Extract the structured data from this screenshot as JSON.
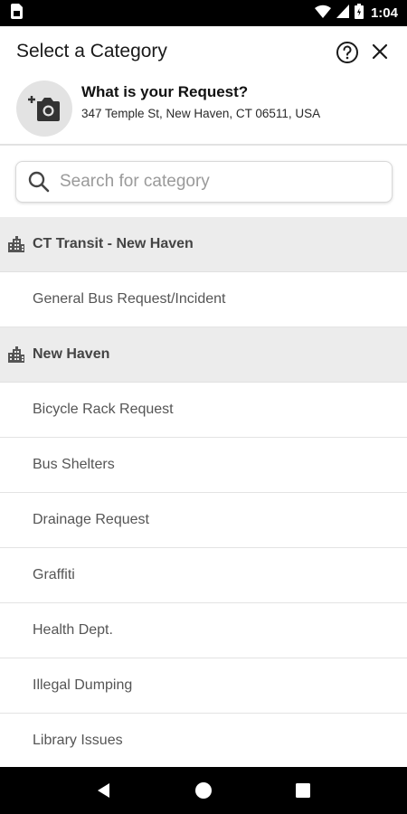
{
  "status_bar": {
    "time": "1:04",
    "icons": [
      "sim-card-icon",
      "wifi-icon",
      "signal-icon",
      "battery-icon"
    ]
  },
  "header": {
    "title": "Select a Category",
    "help_icon": "help-circle-icon",
    "close_icon": "close-icon"
  },
  "request": {
    "title": "What is your Request?",
    "address": "347 Temple St, New Haven, CT 06511, USA",
    "photo_icon": "add-camera-icon"
  },
  "search": {
    "placeholder": "Search for category",
    "value": ""
  },
  "groups": [
    {
      "label": "CT Transit - New Haven",
      "icon": "city-icon"
    },
    {
      "label": "New Haven",
      "icon": "city-icon"
    }
  ],
  "categories": {
    "ct_transit": [
      "General Bus Request/Incident"
    ],
    "new_haven": [
      "Bicycle Rack Request",
      "Bus Shelters",
      "Drainage Request",
      "Graffiti",
      "Health Dept.",
      "Illegal Dumping",
      "Library Issues"
    ]
  },
  "nav": {
    "back_icon": "back-triangle-icon",
    "home_icon": "home-circle-icon",
    "recents_icon": "recents-square-icon"
  },
  "colors": {
    "status_bar": "#000000",
    "group_bg": "#ececec",
    "nav_bar": "#000000",
    "photo_circle": "#e3e3e3"
  }
}
